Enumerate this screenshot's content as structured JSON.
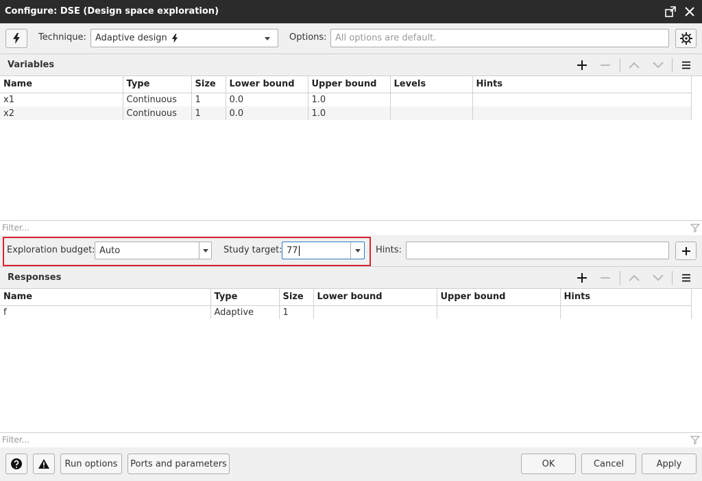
{
  "window": {
    "title": "Configure: DSE (Design space exploration)"
  },
  "toolbar": {
    "technique_label": "Technique:",
    "technique_value": "Adaptive design",
    "options_label": "Options:",
    "options_placeholder": "All options are default."
  },
  "variables": {
    "title": "Variables",
    "columns": [
      "Name",
      "Type",
      "Size",
      "Lower bound",
      "Upper bound",
      "Levels",
      "Hints"
    ],
    "rows": [
      [
        "x1",
        "Continuous",
        "1",
        "0.0",
        "1.0",
        "",
        ""
      ],
      [
        "x2",
        "Continuous",
        "1",
        "0.0",
        "1.0",
        "",
        ""
      ]
    ],
    "filter_placeholder": "Filter..."
  },
  "settings": {
    "budget_label": "Exploration budget:",
    "budget_value": "Auto",
    "target_label": "Study target:",
    "target_value": "77",
    "hints_label": "Hints:",
    "hints_value": ""
  },
  "responses": {
    "title": "Responses",
    "columns": [
      "Name",
      "Type",
      "Size",
      "Lower bound",
      "Upper bound",
      "Hints"
    ],
    "rows": [
      [
        "f",
        "Adaptive",
        "1",
        "",
        "",
        ""
      ]
    ],
    "filter_placeholder": "Filter..."
  },
  "footer": {
    "run_options": "Run options",
    "ports_parameters": "Ports and parameters",
    "ok": "OK",
    "cancel": "Cancel",
    "apply": "Apply"
  },
  "colors": {
    "titlebar": "#2b2b2b",
    "highlight": "#d9232d"
  }
}
